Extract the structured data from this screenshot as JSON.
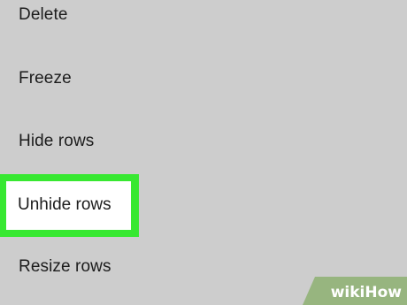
{
  "menu": {
    "items": [
      {
        "label": "Delete"
      },
      {
        "label": "Freeze"
      },
      {
        "label": "Hide rows"
      },
      {
        "label": "Unhide rows"
      },
      {
        "label": "Resize rows"
      }
    ],
    "highlighted_index": 3
  },
  "colors": {
    "background": "#cdcdcd",
    "highlight": "#37e831",
    "text": "#1c1c1c",
    "watermark": "#97b57f"
  },
  "watermark": {
    "wiki": "wiki",
    "how": "How"
  }
}
